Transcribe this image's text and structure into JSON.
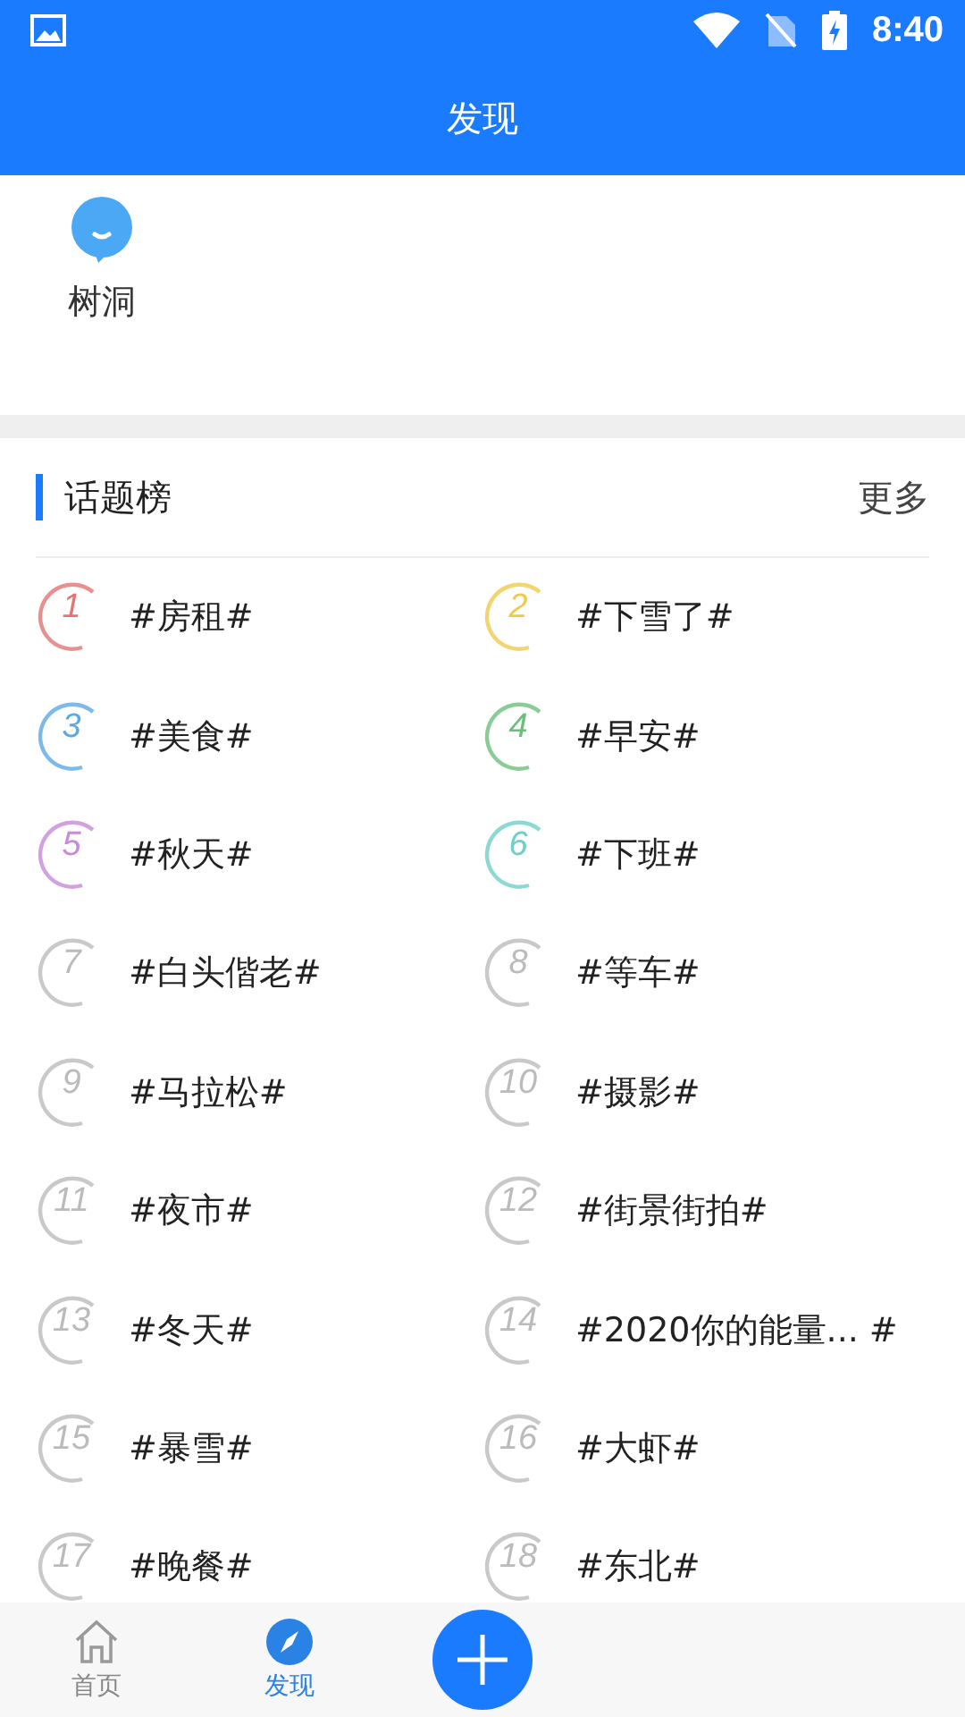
{
  "status_bar": {
    "time": "8:40"
  },
  "header": {
    "title": "发现"
  },
  "shortcuts": [
    {
      "label": "树洞"
    }
  ],
  "topics": {
    "title": "话题榜",
    "more": "更多",
    "items": [
      {
        "rank": "1",
        "label": "#房租#",
        "color": "#e57373"
      },
      {
        "rank": "2",
        "label": "#下雪了#",
        "color": "#f0c94a"
      },
      {
        "rank": "3",
        "label": "#美食#",
        "color": "#5aa9e6"
      },
      {
        "rank": "4",
        "label": "#早安#",
        "color": "#6cbf7a"
      },
      {
        "rank": "5",
        "label": "#秋天#",
        "color": "#c98ad8"
      },
      {
        "rank": "6",
        "label": "#下班#",
        "color": "#6fd0c8"
      },
      {
        "rank": "7",
        "label": "#白头偕老#",
        "color": "#bbbbbb"
      },
      {
        "rank": "8",
        "label": "#等车#",
        "color": "#bbbbbb"
      },
      {
        "rank": "9",
        "label": "#马拉松#",
        "color": "#bbbbbb"
      },
      {
        "rank": "10",
        "label": "#摄影#",
        "color": "#bbbbbb"
      },
      {
        "rank": "11",
        "label": "#夜市#",
        "color": "#bbbbbb"
      },
      {
        "rank": "12",
        "label": "#街景街拍#",
        "color": "#bbbbbb"
      },
      {
        "rank": "13",
        "label": "#冬天#",
        "color": "#bbbbbb"
      },
      {
        "rank": "14",
        "label": "#2020你的能量... #",
        "color": "#bbbbbb"
      },
      {
        "rank": "15",
        "label": "#暴雪#",
        "color": "#bbbbbb"
      },
      {
        "rank": "16",
        "label": "#大虾#",
        "color": "#bbbbbb"
      },
      {
        "rank": "17",
        "label": "#晚餐#",
        "color": "#bbbbbb"
      },
      {
        "rank": "18",
        "label": "#东北#",
        "color": "#bbbbbb"
      }
    ]
  },
  "bottom_nav": [
    {
      "kind": "home",
      "label": "首页",
      "selected": false
    },
    {
      "kind": "discover",
      "label": "发现",
      "selected": true
    },
    {
      "kind": "add"
    }
  ]
}
